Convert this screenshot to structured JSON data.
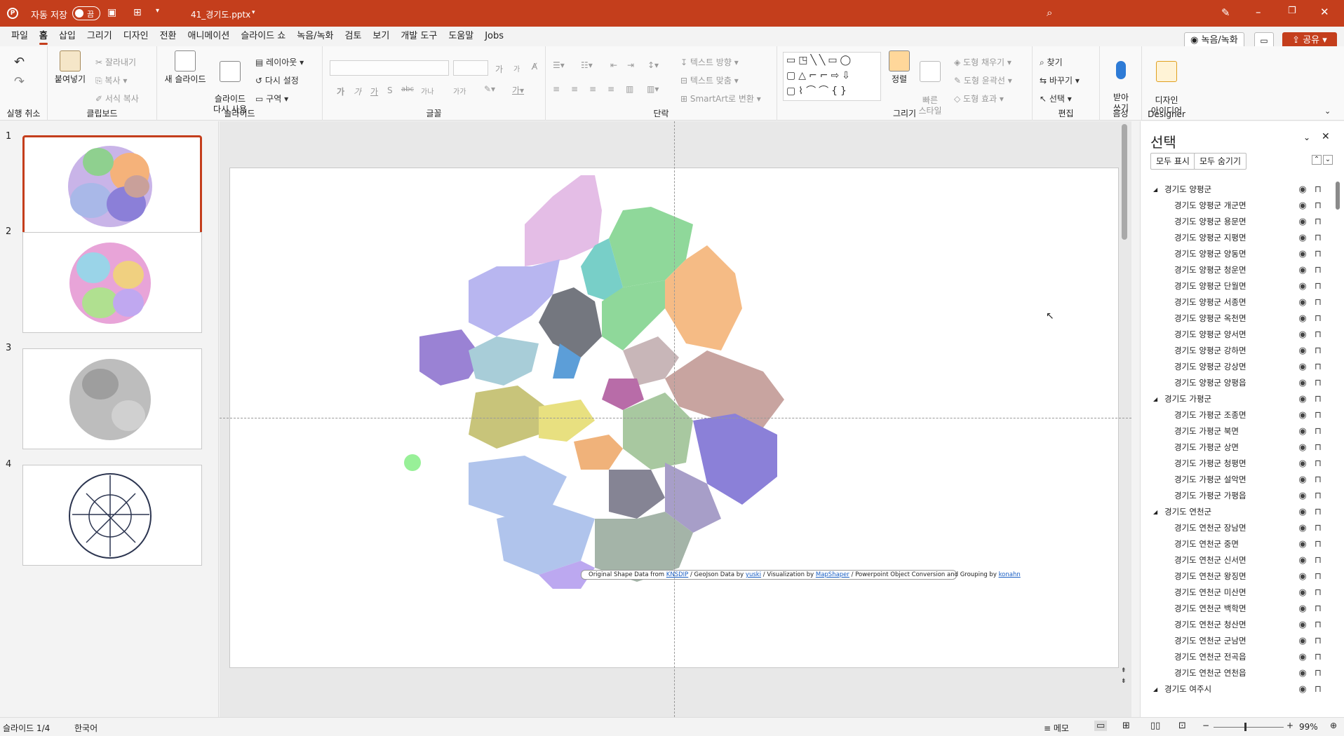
{
  "titlebar": {
    "autosave_label": "자동 저장",
    "autosave_state": "끔",
    "filename": "41_경기도.pptx",
    "brand_color": "#c43e1c"
  },
  "menu": [
    "파일",
    "홈",
    "삽입",
    "그리기",
    "디자인",
    "전환",
    "애니메이션",
    "슬라이드 쇼",
    "녹음/녹화",
    "검토",
    "보기",
    "개발 도구",
    "도움말",
    "Jobs"
  ],
  "menu_active": "홈",
  "menu_right": {
    "record": "녹음/녹화",
    "share": "공유"
  },
  "ribbon": {
    "undo_group": "실행 취소",
    "clipboard": {
      "paste": "붙여넣기",
      "cut": "잘라내기",
      "copy": "복사",
      "format_painter": "서식 복사",
      "label": "클립보드"
    },
    "slides": {
      "new_slide": "새 슬라이드",
      "reuse": "슬라이드\n다시 사용",
      "layout": "레이아웃",
      "reset": "다시 설정",
      "section": "구역",
      "label": "슬라이드"
    },
    "font": {
      "label": "글꼴",
      "bold": "가",
      "italic": "가",
      "underline": "가",
      "shadow": "S",
      "strike": "abc",
      "spacing": "가나",
      "case": "가가",
      "grow": "가",
      "shrink": "가"
    },
    "paragraph": {
      "label": "단락",
      "text_direction": "텍스트 방향",
      "align_text": "텍스트 맞춤",
      "smartart": "SmartArt로 변환"
    },
    "drawing": {
      "label": "그리기",
      "arrange": "정렬",
      "quick_styles": "빠른\n스타일",
      "fill": "도형 채우기",
      "outline": "도형 윤곽선",
      "effects": "도형 효과"
    },
    "editing": {
      "label": "편집",
      "find": "찾기",
      "replace": "바꾸기",
      "select": "선택"
    },
    "voice": {
      "label": "음성",
      "dictate": "받아\n쓰기"
    },
    "designer": {
      "label": "Designer",
      "design_ideas": "디자인\n아이디어"
    }
  },
  "slides": [
    {
      "num": "1"
    },
    {
      "num": "2"
    },
    {
      "num": "3"
    },
    {
      "num": "4"
    }
  ],
  "slide_credit": {
    "prefix": "Original Shape Data from",
    "knsdip": "KNSDIP",
    "geojson": "/ GeoJson Data by",
    "yuski": "yuski",
    "vis": "/ Visualization  by",
    "mapshaper": "MapShaper",
    "conv": "/ Powerpoint Object Conversion and Grouping  by",
    "konahn": "konahn"
  },
  "selection_pane": {
    "title": "선택",
    "show_all": "모두 표시",
    "hide_all": "모두 숨기기",
    "items": [
      {
        "text": "경기도 양평군",
        "level": 0
      },
      {
        "text": "경기도 양평군 개군면",
        "level": 1
      },
      {
        "text": "경기도 양평군 용문면",
        "level": 1
      },
      {
        "text": "경기도 양평군 지평면",
        "level": 1
      },
      {
        "text": "경기도 양평군 양동면",
        "level": 1
      },
      {
        "text": "경기도 양평군 청운면",
        "level": 1
      },
      {
        "text": "경기도 양평군 단월면",
        "level": 1
      },
      {
        "text": "경기도 양평군 서종면",
        "level": 1
      },
      {
        "text": "경기도 양평군 옥천면",
        "level": 1
      },
      {
        "text": "경기도 양평군 양서면",
        "level": 1
      },
      {
        "text": "경기도 양평군 강하면",
        "level": 1
      },
      {
        "text": "경기도 양평군 강상면",
        "level": 1
      },
      {
        "text": "경기도 양평군 양평읍",
        "level": 1
      },
      {
        "text": "경기도 가평군",
        "level": 0
      },
      {
        "text": "경기도 가평군 조종면",
        "level": 1
      },
      {
        "text": "경기도 가평군 북면",
        "level": 1
      },
      {
        "text": "경기도 가평군 상면",
        "level": 1
      },
      {
        "text": "경기도 가평군 청평면",
        "level": 1
      },
      {
        "text": "경기도 가평군 설악면",
        "level": 1
      },
      {
        "text": "경기도 가평군 가평읍",
        "level": 1
      },
      {
        "text": "경기도 연천군",
        "level": 0
      },
      {
        "text": "경기도 연천군 장남면",
        "level": 1
      },
      {
        "text": "경기도 연천군 중면",
        "level": 1
      },
      {
        "text": "경기도 연천군 신서면",
        "level": 1
      },
      {
        "text": "경기도 연천군 왕징면",
        "level": 1
      },
      {
        "text": "경기도 연천군 미산면",
        "level": 1
      },
      {
        "text": "경기도 연천군 백학면",
        "level": 1
      },
      {
        "text": "경기도 연천군 청산면",
        "level": 1
      },
      {
        "text": "경기도 연천군 군남면",
        "level": 1
      },
      {
        "text": "경기도 연천군 전곡읍",
        "level": 1
      },
      {
        "text": "경기도 연천군 연천읍",
        "level": 1
      },
      {
        "text": "경기도 여주시",
        "level": 0
      }
    ]
  },
  "status": {
    "slide": "슬라이드 1/4",
    "lang": "한국어",
    "notes": "메모",
    "zoom": "99%"
  }
}
